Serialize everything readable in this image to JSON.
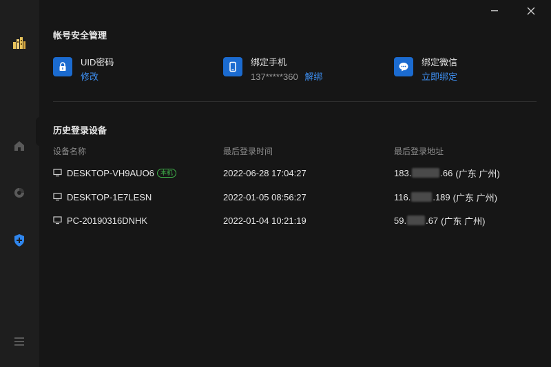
{
  "sidebar": {
    "items": [
      {
        "icon": "app-logo-icon"
      },
      {
        "icon": "home-icon"
      },
      {
        "icon": "sync-icon"
      },
      {
        "icon": "shield-plus-icon",
        "active": true
      },
      {
        "icon": "menu-icon"
      }
    ]
  },
  "window": {
    "minimize_icon": "minimize-icon",
    "close_icon": "close-icon"
  },
  "account_security": {
    "title": "帐号安全管理",
    "items": [
      {
        "icon": "lock-icon",
        "title": "UID密码",
        "action": "修改"
      },
      {
        "icon": "phone-icon",
        "title": "绑定手机",
        "value": "137*****360",
        "action": "解绑"
      },
      {
        "icon": "wechat-icon",
        "title": "绑定微信",
        "action": "立即绑定"
      }
    ]
  },
  "login_history": {
    "title": "历史登录设备",
    "columns": [
      "设备名称",
      "最后登录时间",
      "最后登录地址"
    ],
    "rows": [
      {
        "device": "DESKTOP-VH9AUO6",
        "badge": "本机",
        "time": "2022-06-28 17:04:27",
        "ip_prefix": "183.",
        "ip_suffix": ".66",
        "location": "(广东 广州)"
      },
      {
        "device": "DESKTOP-1E7LESN",
        "time": "2022-01-05 08:56:27",
        "ip_prefix": "116.",
        "ip_suffix": ".189",
        "location": "(广东 广州)"
      },
      {
        "device": "PC-20190316DNHK",
        "time": "2022-01-04 10:21:19",
        "ip_prefix": "59.",
        "ip_suffix": ".67",
        "location": "(广东 广州)"
      }
    ]
  },
  "colors": {
    "accent": "#1b6bd0",
    "link": "#3d8ef0",
    "badge": "#3fb24a"
  }
}
